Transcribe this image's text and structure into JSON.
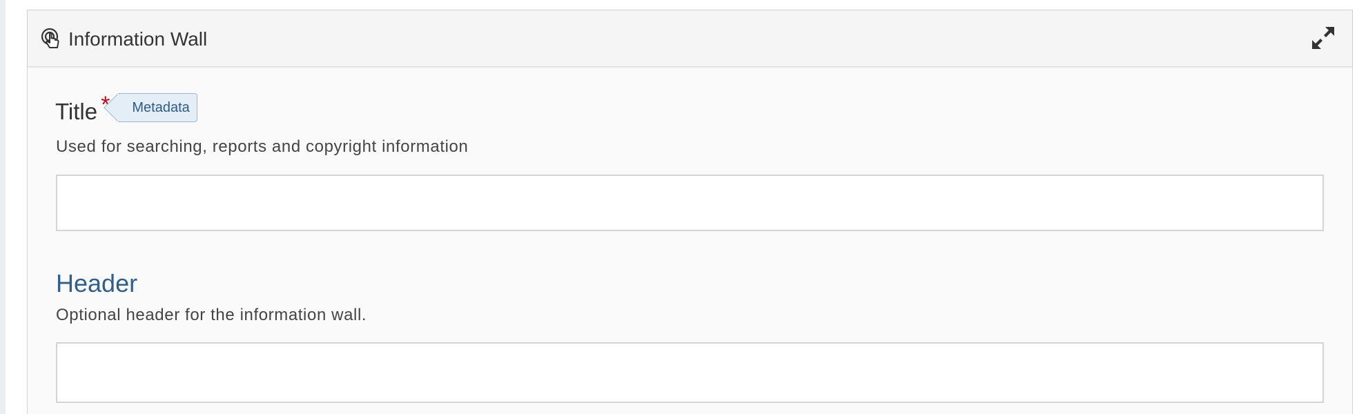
{
  "panel": {
    "title": "Information Wall",
    "title_icon": "hand-pointer-icon",
    "expand_icon": "expand-arrows-icon"
  },
  "title_field": {
    "label": "Title",
    "required_marker": "*",
    "tag": "Metadata",
    "description": "Used for searching, reports and copyright information",
    "value": "",
    "placeholder": ""
  },
  "header_field": {
    "label": "Header",
    "description": "Optional header for the information wall.",
    "value": "",
    "placeholder": ""
  },
  "colors": {
    "required": "#d0021b",
    "heading": "#2e5f91",
    "tag_bg": "#e4eef7",
    "tag_text": "#2b5b8a"
  }
}
